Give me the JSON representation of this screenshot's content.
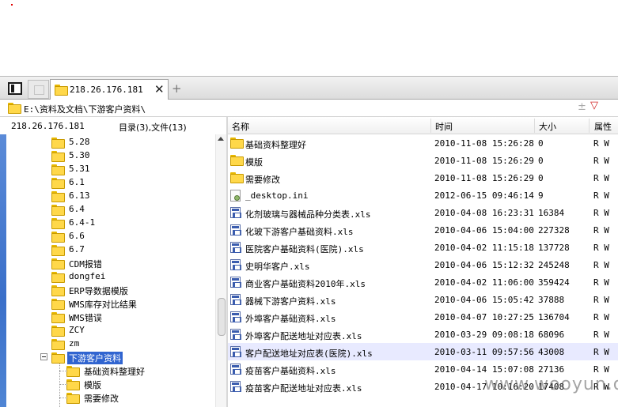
{
  "tab": {
    "label": "218.26.176.181",
    "close": "✕",
    "add": "+"
  },
  "address": {
    "path": "E:\\资料及文档\\下游客户资料\\",
    "plus": "±",
    "dropdown": "▽"
  },
  "left": {
    "host": "218.26.176.181",
    "count": "目录(3),文件(13)"
  },
  "tree": [
    {
      "label": "5.28"
    },
    {
      "label": "5.30"
    },
    {
      "label": "5.31"
    },
    {
      "label": "6.1"
    },
    {
      "label": "6.13"
    },
    {
      "label": "6.4"
    },
    {
      "label": "6.4-1"
    },
    {
      "label": "6.6"
    },
    {
      "label": "6.7"
    },
    {
      "label": "CDM报错"
    },
    {
      "label": "dongfei"
    },
    {
      "label": "ERP导数据模版"
    },
    {
      "label": "WMS库存对比结果"
    },
    {
      "label": "WMS错误"
    },
    {
      "label": "ZCY"
    },
    {
      "label": "zm"
    },
    {
      "label": "下游客户资料",
      "selected": true
    },
    {
      "label": "基础资料整理好",
      "child": true
    },
    {
      "label": "模版",
      "child": true
    },
    {
      "label": "需要修改",
      "child": true
    }
  ],
  "columns": {
    "name": "名称",
    "time": "时间",
    "size": "大小",
    "attr": "属性"
  },
  "files": [
    {
      "icon": "folder-icon",
      "name": "基础资料整理好",
      "time": "2010-11-08 15:26:28",
      "size": "0",
      "attr": "R W"
    },
    {
      "icon": "folder-icon",
      "name": "模版",
      "time": "2010-11-08 15:26:29",
      "size": "0",
      "attr": "R W"
    },
    {
      "icon": "folder-icon",
      "name": "需要修改",
      "time": "2010-11-08 15:26:29",
      "size": "0",
      "attr": "R W"
    },
    {
      "icon": "ini-file-icon",
      "name": "_desktop.ini",
      "time": "2012-06-15 09:46:14",
      "size": "9",
      "attr": "R W"
    },
    {
      "icon": "excel-file-icon",
      "name": "化剂玻璃与器械品种分类表.xls",
      "time": "2010-04-08 16:23:31",
      "size": "16384",
      "attr": "R W"
    },
    {
      "icon": "excel-file-icon",
      "name": "化玻下游客户基础资料.xls",
      "time": "2010-04-06 15:04:00",
      "size": "227328",
      "attr": "R W"
    },
    {
      "icon": "excel-file-icon",
      "name": "医院客户基础资料(医院).xls",
      "time": "2010-04-02 11:15:18",
      "size": "137728",
      "attr": "R W"
    },
    {
      "icon": "excel-file-icon",
      "name": "史明华客户.xls",
      "time": "2010-04-06 15:12:32",
      "size": "245248",
      "attr": "R W"
    },
    {
      "icon": "excel-file-icon",
      "name": "商业客户基础资料2010年.xls",
      "time": "2010-04-02 11:06:00",
      "size": "359424",
      "attr": "R W"
    },
    {
      "icon": "excel-file-icon",
      "name": "器械下游客户资料.xls",
      "time": "2010-04-06 15:05:42",
      "size": "37888",
      "attr": "R W"
    },
    {
      "icon": "excel-file-icon",
      "name": "外埠客户基础资料.xls",
      "time": "2010-04-07 10:27:25",
      "size": "136704",
      "attr": "R W"
    },
    {
      "icon": "excel-file-icon",
      "name": "外埠客户配送地址对应表.xls",
      "time": "2010-03-29 09:08:18",
      "size": "68096",
      "attr": "R W"
    },
    {
      "icon": "excel-file-icon",
      "name": "客户配送地址对应表(医院).xls",
      "time": "2010-03-11 09:57:56",
      "size": "43008",
      "attr": "R W",
      "highlight": true
    },
    {
      "icon": "excel-file-icon",
      "name": "疫苗客户基础资料.xls",
      "time": "2010-04-14 15:07:08",
      "size": "27136",
      "attr": "R W"
    },
    {
      "icon": "excel-file-icon",
      "name": "疫苗客户配送地址对应表.xls",
      "time": "2010-04-17 10:16:20",
      "size": "17408",
      "attr": "R W"
    }
  ],
  "watermark": "www.wooyun.org"
}
